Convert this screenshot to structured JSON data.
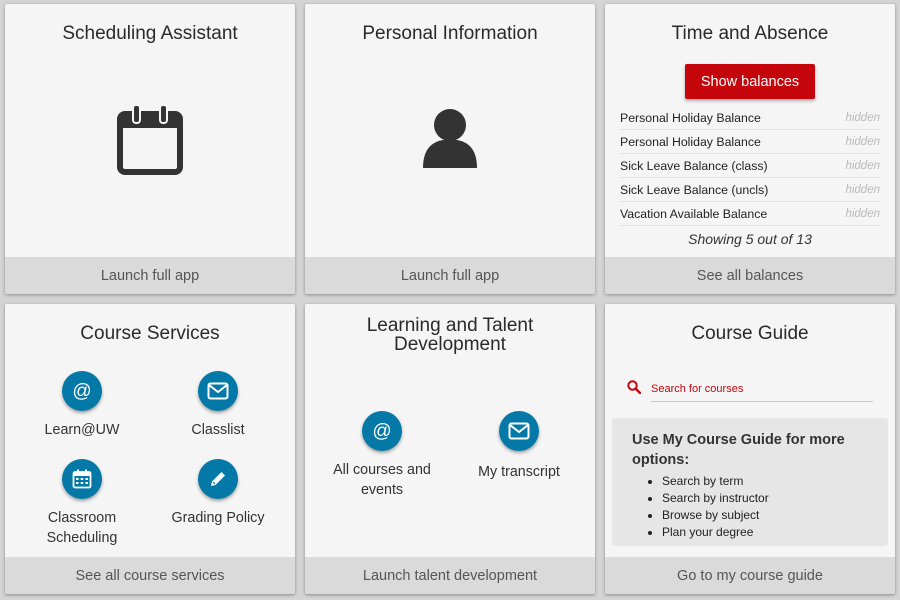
{
  "scheduling": {
    "title": "Scheduling Assistant",
    "icon": "calendar-icon",
    "footer": "Launch full app"
  },
  "personal": {
    "title": "Personal Information",
    "icon": "person-icon",
    "footer": "Launch full app"
  },
  "time_absence": {
    "title": "Time and Absence",
    "button": "Show balances",
    "balances": [
      {
        "label": "Personal Holiday Balance",
        "value": "hidden"
      },
      {
        "label": "Personal Holiday Balance",
        "value": "hidden"
      },
      {
        "label": "Sick Leave Balance (class)",
        "value": "hidden"
      },
      {
        "label": "Sick Leave Balance (uncls)",
        "value": "hidden"
      },
      {
        "label": "Vacation Available Balance",
        "value": "hidden"
      }
    ],
    "showing": "Showing 5 out of 13",
    "footer": "See all balances"
  },
  "course_services": {
    "title": "Course Services",
    "items": [
      {
        "label": "Learn@UW",
        "icon": "at-sign-icon"
      },
      {
        "label": "Classlist",
        "icon": "envelope-icon"
      },
      {
        "label": "Classroom Scheduling",
        "icon": "calendar-icon"
      },
      {
        "label": "Grading Policy",
        "icon": "pencil-icon"
      }
    ],
    "footer": "See all course services"
  },
  "learning": {
    "title": "Learning and Talent Development",
    "items": [
      {
        "label": "All courses and events",
        "icon": "at-sign-icon"
      },
      {
        "label": "My transcript",
        "icon": "envelope-icon"
      }
    ],
    "footer": "Launch talent development"
  },
  "course_guide": {
    "title": "Course Guide",
    "search_placeholder": "Search for courses",
    "info_heading": "Use My Course Guide for more options:",
    "options": [
      "Search by term",
      "Search by instructor",
      "Browse by subject",
      "Plan your degree"
    ],
    "footer": "Go to my course guide"
  },
  "colors": {
    "accent_red": "#c5050c",
    "icon_blue": "#0479a8",
    "card_bg": "#f5f5f5",
    "footer_bg": "#dadada"
  }
}
